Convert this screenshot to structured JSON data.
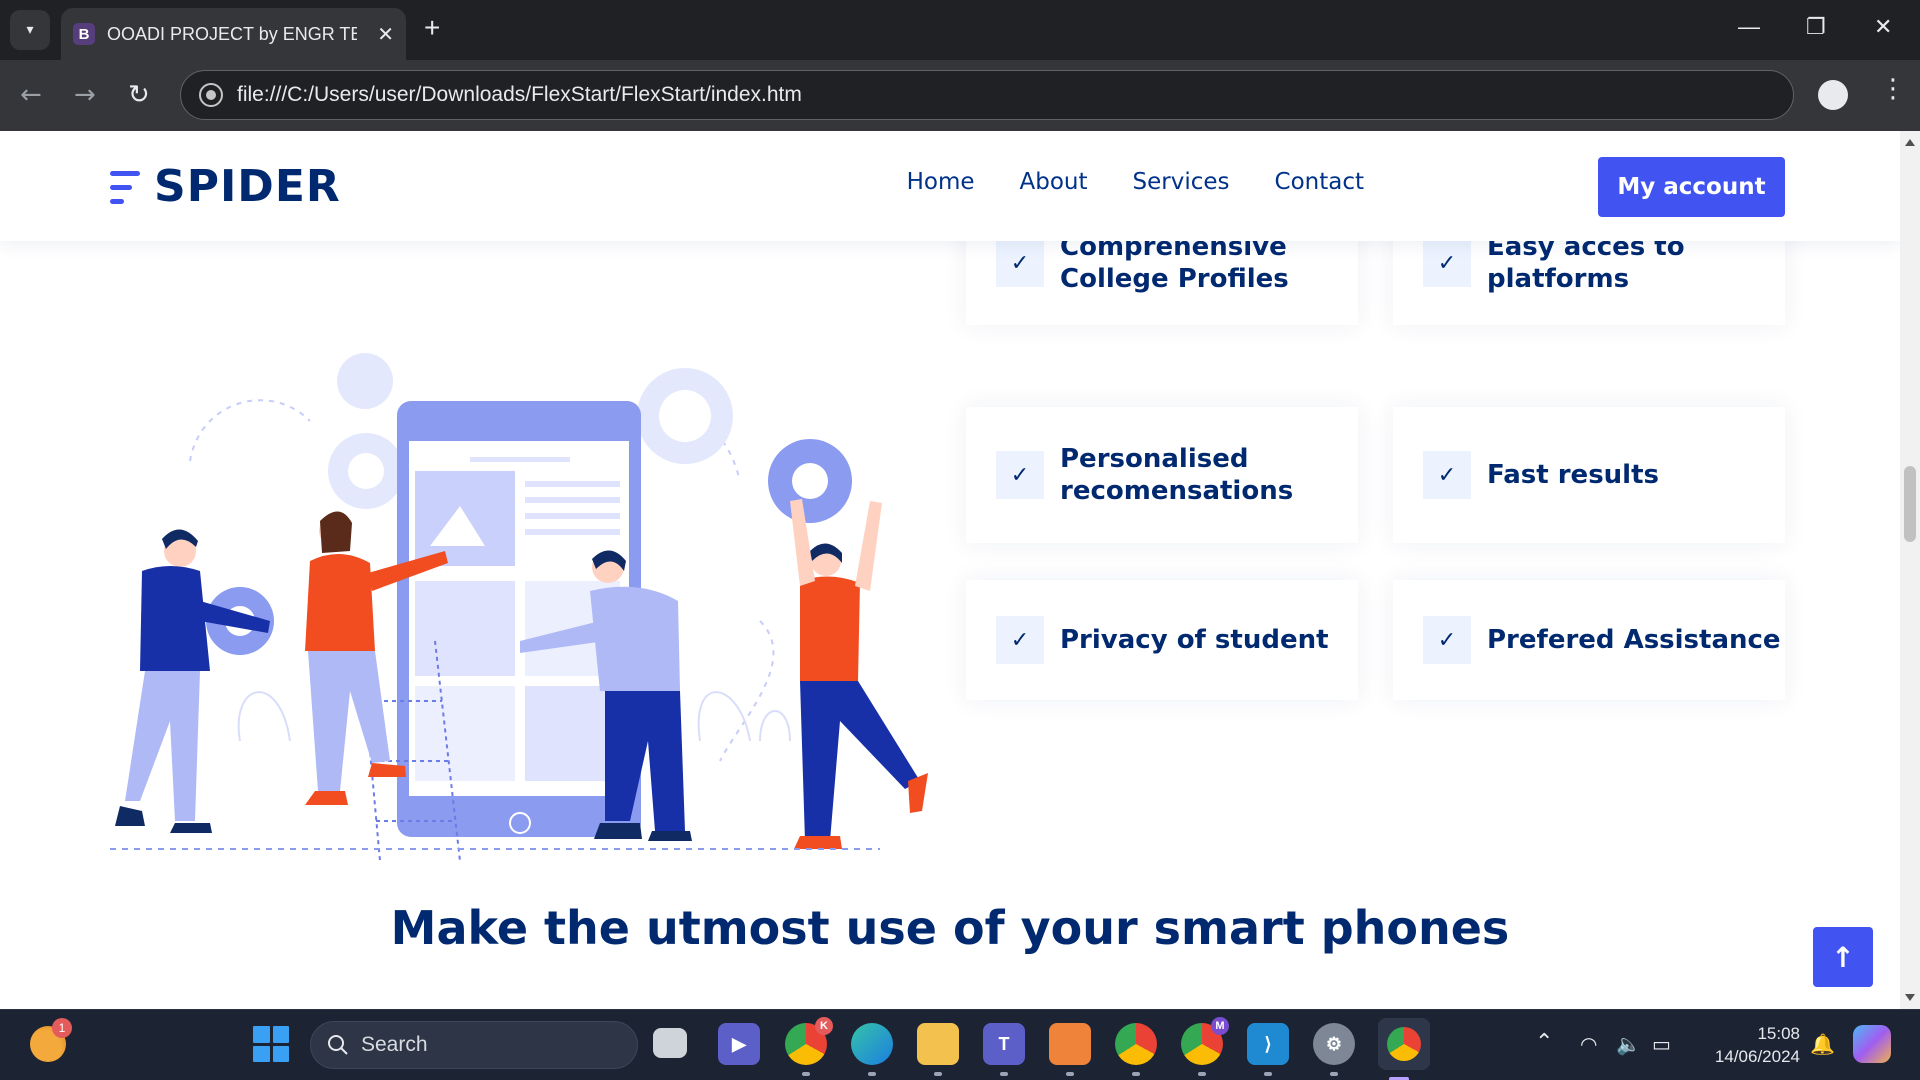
{
  "browser": {
    "tab_title": "OOADI PROJECT by ENGR TEKO",
    "tab_favicon_letter": "B",
    "new_tab_label": "+",
    "url": "file:///C:/Users/user/Downloads/FlexStart/FlexStart/index.htm",
    "icons": [
      "tab-search-icon",
      "close-icon",
      "back-icon",
      "forward-icon",
      "reload-icon",
      "site-info-icon",
      "profile-icon",
      "menu-icon",
      "minimize-icon",
      "restore-icon",
      "window-close-icon"
    ]
  },
  "site": {
    "logo_text": "SPIDER",
    "nav": [
      "Home",
      "About",
      "Services",
      "Contact"
    ],
    "account_button": "My account",
    "features": [
      {
        "line1": "Comprehensive",
        "line2": "College Profiles"
      },
      {
        "line1": "Easy acces to",
        "line2": "platforms"
      },
      {
        "line1": "Personalised",
        "line2": "recomensations"
      },
      {
        "line1": "Fast results",
        "line2": ""
      },
      {
        "line1": "Privacy of student",
        "line2": ""
      },
      {
        "line1": "Prefered Assistance",
        "line2": ""
      }
    ],
    "section_title": "Make the utmost use of your smart phones",
    "colors": {
      "brand": "#4154f1",
      "heading": "#012970",
      "accent_orange": "#f14d21",
      "illustration_blue": "#8a9bf0"
    }
  },
  "taskbar": {
    "weather_badge": "1",
    "search_placeholder": "Search",
    "apps": [
      "task-view",
      "meet",
      "chrome-profile-k",
      "edge",
      "file-explorer",
      "teams",
      "pdf-reader",
      "chrome-profile",
      "chrome-profile-m",
      "vscode",
      "settings",
      "chrome"
    ],
    "chrome_badge_k": "K",
    "chrome_badge_m": "M",
    "time": "15:08",
    "date": "14/06/2024"
  }
}
